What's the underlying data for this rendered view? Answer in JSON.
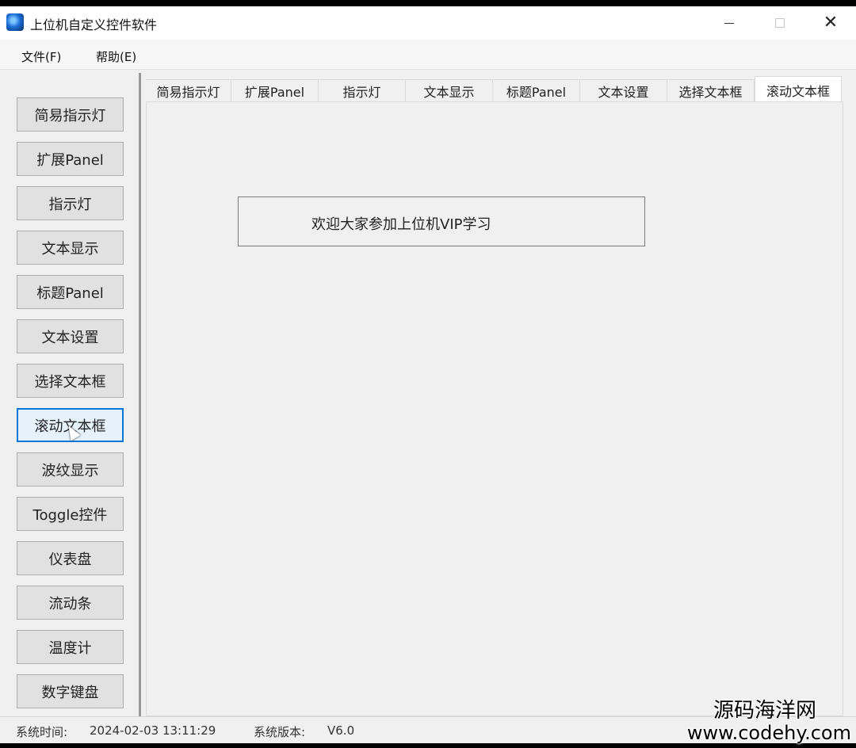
{
  "window": {
    "title": "上位机自定义控件软件",
    "minimize_glyph": "",
    "maximize_glyph": "",
    "close_glyph": "✕"
  },
  "menu": {
    "file": "文件(F)",
    "help": "帮助(E)"
  },
  "sidebar": {
    "items": [
      {
        "label": "简易指示灯"
      },
      {
        "label": "扩展Panel"
      },
      {
        "label": "指示灯"
      },
      {
        "label": "文本显示"
      },
      {
        "label": "标题Panel"
      },
      {
        "label": "文本设置"
      },
      {
        "label": "选择文本框"
      },
      {
        "label": "滚动文本框"
      },
      {
        "label": "波纹显示"
      },
      {
        "label": "Toggle控件"
      },
      {
        "label": "仪表盘"
      },
      {
        "label": "流动条"
      },
      {
        "label": "温度计"
      },
      {
        "label": "数字键盘"
      }
    ],
    "active_index": 7
  },
  "tabs": {
    "items": [
      {
        "label": "简易指示灯"
      },
      {
        "label": "扩展Panel"
      },
      {
        "label": "指示灯"
      },
      {
        "label": "文本显示"
      },
      {
        "label": "标题Panel"
      },
      {
        "label": "文本设置"
      },
      {
        "label": "选择文本框"
      },
      {
        "label": "滚动文本框"
      }
    ],
    "active_index": 7
  },
  "content": {
    "marquee_text": "欢迎大家参加上位机VIP学习"
  },
  "status": {
    "time_label": "系统时间:",
    "time_value": "2024-02-03 13:11:29",
    "version_label": "系统版本:",
    "version_value": "V6.0"
  },
  "watermark": {
    "line1": "源码海洋网",
    "line2": "www.codehy.com"
  }
}
